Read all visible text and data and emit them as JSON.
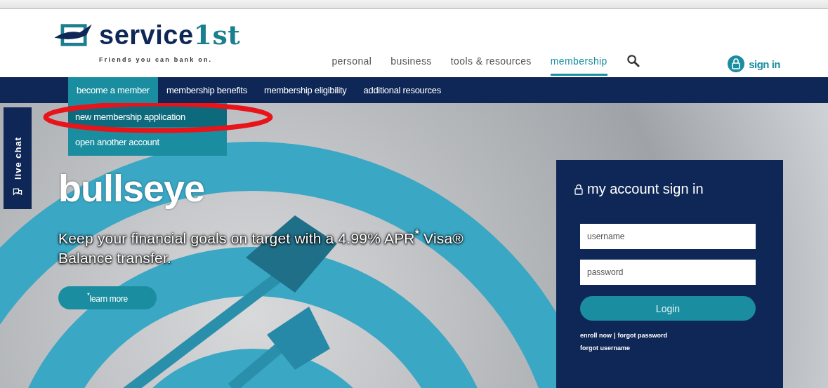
{
  "header": {
    "logo": {
      "primary": "service",
      "accent": "1st",
      "tagline": "Friends you can bank on."
    },
    "nav": [
      {
        "label": "personal",
        "selected": false
      },
      {
        "label": "business",
        "selected": false
      },
      {
        "label": "tools & resources",
        "selected": false
      },
      {
        "label": "membership",
        "selected": true
      }
    ],
    "sign_in": "sign in"
  },
  "subnav": [
    {
      "label": "become a member",
      "selected": true
    },
    {
      "label": "membership benefits",
      "selected": false
    },
    {
      "label": "membership eligibility",
      "selected": false
    },
    {
      "label": "additional resources",
      "selected": false
    }
  ],
  "dropdown": [
    {
      "label": "new membership application",
      "selected": true
    },
    {
      "label": "open another account",
      "selected": false
    }
  ],
  "live_chat": "live chat",
  "hero": {
    "title": "bullseye",
    "text": "Keep your financial goals on target with a 4.99% APR$^{*}$ Visa® Balance transfer.",
    "button": "$^{*}$learn more"
  },
  "signin_card": {
    "title": "my account sign in",
    "username": {
      "placeholder": "username"
    },
    "password": {
      "placeholder": "password"
    },
    "button": "Login",
    "links": [
      {
        "label": "enroll now"
      },
      {
        "label": "forgot password"
      }
    ],
    "separator": "|",
    "link_below": "forgot username"
  }
}
